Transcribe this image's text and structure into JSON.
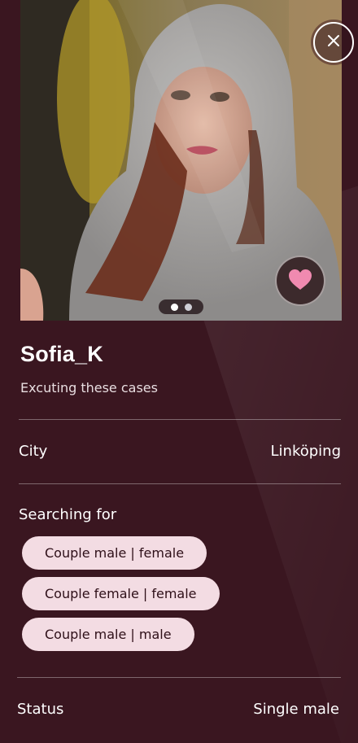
{
  "profile": {
    "username": "Sofia_K",
    "tagline": "Excuting these cases",
    "photo_count": 2,
    "active_photo_index": 0
  },
  "details": {
    "city_label": "City",
    "city_value": "Linköping",
    "searching_title": "Searching for",
    "searching_for": [
      "Couple male | female",
      "Couple female | female",
      "Couple male | male"
    ],
    "status_label": "Status",
    "status_value": "Single male"
  },
  "icons": {
    "close": "close-icon",
    "like": "heart-icon"
  },
  "colors": {
    "background": "#3a1620",
    "chip": "#f3dce3",
    "heart": "#f08ab0"
  }
}
